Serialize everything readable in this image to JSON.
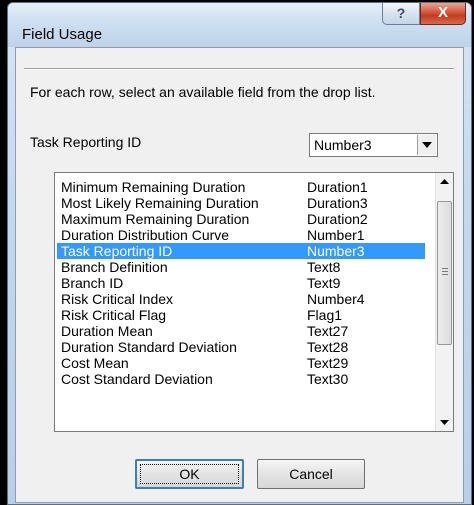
{
  "dialog": {
    "title": "Field Usage",
    "help_symbol": "?",
    "close_symbol": "X",
    "instruction": "For each row, select an available field from the drop list.",
    "combo_label": "Task Reporting ID",
    "combo_value": "Number3",
    "ok_label": "OK",
    "cancel_label": "Cancel"
  },
  "list": {
    "selected_index": 4,
    "rows": [
      {
        "name": "Minimum Remaining Duration",
        "field": "Duration1"
      },
      {
        "name": "Most Likely Remaining Duration",
        "field": "Duration3"
      },
      {
        "name": "Maximum Remaining Duration",
        "field": "Duration2"
      },
      {
        "name": "Duration Distribution Curve",
        "field": "Number1"
      },
      {
        "name": "Task Reporting ID",
        "field": "Number3"
      },
      {
        "name": "Branch Definition",
        "field": "Text8"
      },
      {
        "name": "Branch ID",
        "field": "Text9"
      },
      {
        "name": "Risk Critical Index",
        "field": "Number4"
      },
      {
        "name": "Risk Critical Flag",
        "field": "Flag1"
      },
      {
        "name": "Duration Mean",
        "field": "Text27"
      },
      {
        "name": "Duration Standard Deviation",
        "field": "Text28"
      },
      {
        "name": "Cost Mean",
        "field": "Text29"
      },
      {
        "name": "Cost Standard Deviation",
        "field": "Text30"
      }
    ]
  },
  "colors": {
    "selection": "#3399ff",
    "close_button": "#c33b1f"
  }
}
